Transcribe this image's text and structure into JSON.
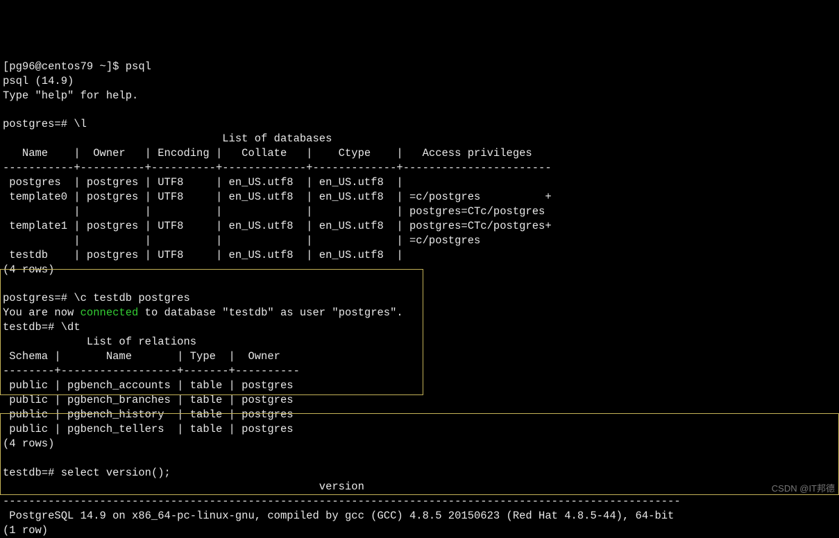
{
  "shell_prompt": "[pg96@centos79 ~]$ ",
  "cmd_psql": "psql",
  "psql_banner_line1": "psql (14.9)",
  "psql_banner_line2": "Type \"help\" for help.",
  "blank": "",
  "pg_prompt": "postgres=# ",
  "cmd_list": "\\l",
  "db_title": "                                  List of databases",
  "db_header": "   Name    |  Owner   | Encoding |   Collate   |    Ctype    |   Access privileges   ",
  "db_sep": "-----------+----------+----------+-------------+-------------+-----------------------",
  "db_row1": " postgres  | postgres | UTF8     | en_US.utf8  | en_US.utf8  | ",
  "db_row2": " template0 | postgres | UTF8     | en_US.utf8  | en_US.utf8  | =c/postgres          +",
  "db_row2b": "           |          |          |             |             | postgres=CTc/postgres",
  "db_row3": " template1 | postgres | UTF8     | en_US.utf8  | en_US.utf8  | postgres=CTc/postgres+",
  "db_row3b": "           |          |          |             |             | =c/postgres",
  "db_row4": " testdb    | postgres | UTF8     | en_US.utf8  | en_US.utf8  | ",
  "db_rows_count": "(4 rows)",
  "cmd_connect": "\\c testdb postgres",
  "connect_msg_pre": "You are now ",
  "connect_msg_green": "connected",
  "connect_msg_post": " to database \"testdb\" as user \"postgres\".",
  "testdb_prompt": "testdb=# ",
  "cmd_dt": "\\dt",
  "rel_title": "             List of relations",
  "rel_header": " Schema |       Name       | Type  |  Owner   ",
  "rel_sep": "--------+------------------+-------+----------",
  "rel_row1": " public | pgbench_accounts | table | postgres",
  "rel_row2": " public | pgbench_branches | table | postgres",
  "rel_row3": " public | pgbench_history  | table | postgres",
  "rel_row4": " public | pgbench_tellers  | table | postgres",
  "rel_rows_count": "(4 rows)",
  "cmd_version": "select version();",
  "ver_header": "                                                 version                                                 ",
  "ver_sep": "---------------------------------------------------------------------------------------------------------",
  "ver_row": " PostgreSQL 14.9 on x86_64-pc-linux-gnu, compiled by gcc (GCC) 4.8.5 20150623 (Red Hat 4.8.5-44), 64-bit",
  "ver_rows_count": "(1 row)",
  "watermark": "CSDN @IT邦德",
  "chart_data": {
    "type": "table",
    "tables": [
      {
        "title": "List of databases",
        "columns": [
          "Name",
          "Owner",
          "Encoding",
          "Collate",
          "Ctype",
          "Access privileges"
        ],
        "rows": [
          [
            "postgres",
            "postgres",
            "UTF8",
            "en_US.utf8",
            "en_US.utf8",
            ""
          ],
          [
            "template0",
            "postgres",
            "UTF8",
            "en_US.utf8",
            "en_US.utf8",
            "=c/postgres + postgres=CTc/postgres"
          ],
          [
            "template1",
            "postgres",
            "UTF8",
            "en_US.utf8",
            "en_US.utf8",
            "postgres=CTc/postgres + =c/postgres"
          ],
          [
            "testdb",
            "postgres",
            "UTF8",
            "en_US.utf8",
            "en_US.utf8",
            ""
          ]
        ]
      },
      {
        "title": "List of relations",
        "columns": [
          "Schema",
          "Name",
          "Type",
          "Owner"
        ],
        "rows": [
          [
            "public",
            "pgbench_accounts",
            "table",
            "postgres"
          ],
          [
            "public",
            "pgbench_branches",
            "table",
            "postgres"
          ],
          [
            "public",
            "pgbench_history",
            "table",
            "postgres"
          ],
          [
            "public",
            "pgbench_tellers",
            "table",
            "postgres"
          ]
        ]
      },
      {
        "title": "version",
        "columns": [
          "version"
        ],
        "rows": [
          [
            "PostgreSQL 14.9 on x86_64-pc-linux-gnu, compiled by gcc (GCC) 4.8.5 20150623 (Red Hat 4.8.5-44), 64-bit"
          ]
        ]
      }
    ]
  }
}
